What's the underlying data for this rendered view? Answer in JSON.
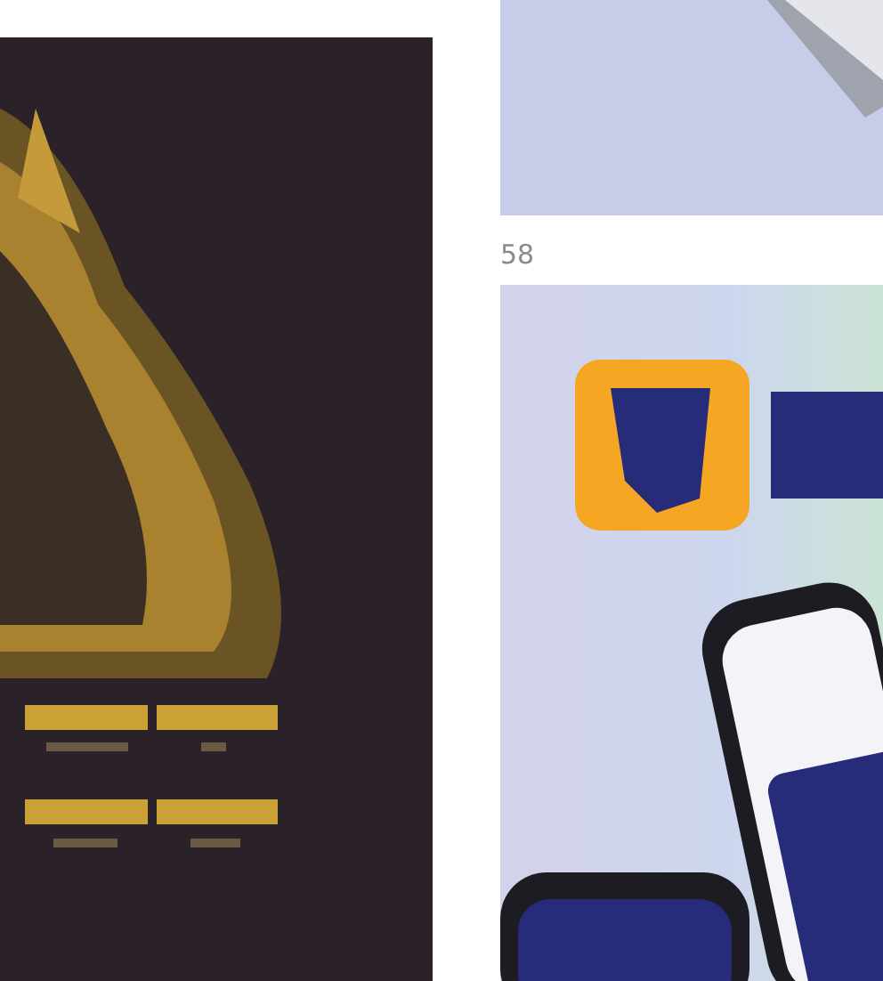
{
  "left_column": [
    {
      "kind": "picture"
    }
  ],
  "right_column": [
    {
      "kind": "picture"
    },
    {
      "kind": "caption",
      "text": "58"
    },
    {
      "kind": "picture"
    }
  ]
}
